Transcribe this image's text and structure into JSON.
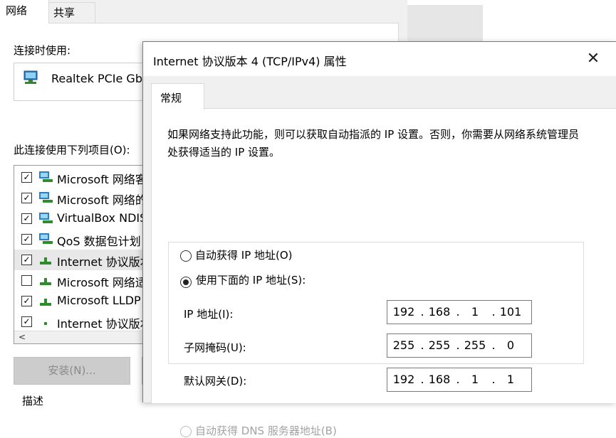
{
  "bg_window": {
    "tabs": [
      "网络",
      "共享"
    ],
    "connect_using_label": "连接时使用:",
    "adapter_name": "Realtek PCIe Gb",
    "items_label": "此连接使用下列项目(O):",
    "items": [
      {
        "label": "Microsoft 网络客",
        "checked": true,
        "icon": "network-client-icon"
      },
      {
        "label": "Microsoft 网络的",
        "checked": true,
        "icon": "network-client-icon"
      },
      {
        "label": "VirtualBox NDIS",
        "checked": true,
        "icon": "network-client-icon"
      },
      {
        "label": "QoS 数据包计划",
        "checked": true,
        "icon": "network-client-icon"
      },
      {
        "label": "Internet 协议版本",
        "checked": true,
        "icon": "protocol-icon"
      },
      {
        "label": "Microsoft 网络适",
        "checked": false,
        "icon": "protocol-icon"
      },
      {
        "label": "Microsoft LLDP",
        "checked": true,
        "icon": "protocol-icon"
      },
      {
        "label": "Internet 协议版本",
        "checked": true,
        "icon": "protocol-icon"
      }
    ],
    "scroll_left": "<",
    "install_button": "安装(N)...",
    "description_label": "描述"
  },
  "dialog": {
    "title": "Internet 协议版本 4 (TCP/IPv4) 属性",
    "close": "✕",
    "tab": "常规",
    "description": "如果网络支持此功能，则可以获取自动指派的 IP 设置。否则，你需要从网络系统管理员处获得适当的 IP 设置。",
    "auto_ip_label": "自动获得 IP 地址(O)",
    "manual_ip_label": "使用下面的 IP 地址(S):",
    "ip_label": "IP 地址(I):",
    "ip_value": [
      "192",
      "168",
      "1",
      "101"
    ],
    "subnet_label": "子网掩码(U):",
    "subnet_value": [
      "255",
      "255",
      "255",
      "0"
    ],
    "gateway_label": "默认网关(D):",
    "gateway_value": [
      "192",
      "168",
      "1",
      "1"
    ],
    "auto_dns_label": "自动获得 DNS 服务器地址(B)"
  }
}
